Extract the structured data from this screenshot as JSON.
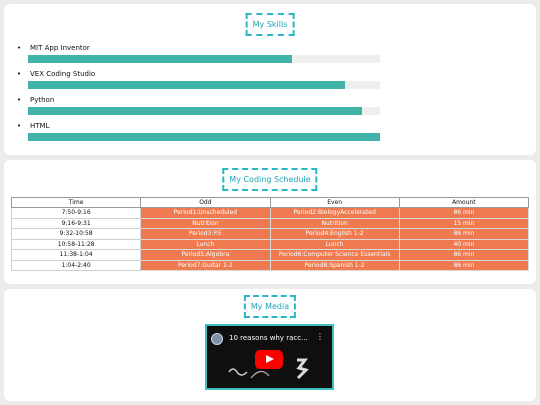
{
  "skills": {
    "heading": "My Skills",
    "items": [
      {
        "label": "MIT App Inventor",
        "level": 0.75
      },
      {
        "label": "VEX Coding Studio",
        "level": 0.9
      },
      {
        "label": "Python",
        "level": 0.95
      },
      {
        "label": "HTML",
        "level": 1.0
      }
    ]
  },
  "schedule": {
    "heading": "My Coding Schedule",
    "columns": [
      "Time",
      "Odd",
      "Even",
      "Amount"
    ],
    "rows": [
      [
        "7:50-9:16",
        "Period1:Unscheduled",
        "Period2:BiologyAccelerated",
        "86 min"
      ],
      [
        "9:16-9:31",
        "Nutrition",
        "Nutrition",
        "15 min"
      ],
      [
        "9:32-10:58",
        "Period3:P.E",
        "Period4:English 1-2",
        "86 min"
      ],
      [
        "10:58-11:28",
        "Lunch",
        "Lunch",
        "40 min"
      ],
      [
        "11:38-1:04",
        "Period5:Algebra",
        "Period6:Computer Science Essentials",
        "86 min"
      ],
      [
        "1:04-2:40",
        "Period7:Guitar 1-2",
        "Period8:Spanish 1-2",
        "86 min"
      ]
    ],
    "accent_color": "#f07a4f"
  },
  "media": {
    "heading": "My Media",
    "video_title": "10 reasons why racc...",
    "menu_icon": "more-vert-icon",
    "play_icon": "youtube-play-icon"
  },
  "colors": {
    "teal": "#29b7c6",
    "bar": "#41b3a8",
    "orange": "#f07a4f"
  }
}
